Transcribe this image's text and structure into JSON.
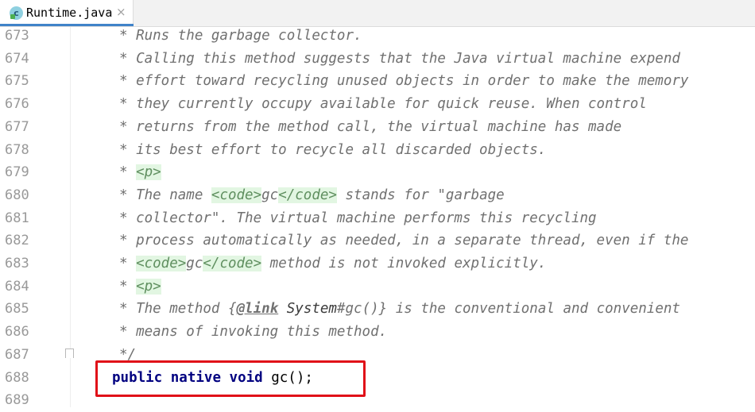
{
  "tab": {
    "icon": "class-icon",
    "icon_letter": "c",
    "label": "Runtime.java",
    "close": "×"
  },
  "lines": [
    {
      "n": "673",
      "text": "* Runs the garbage collector."
    },
    {
      "n": "674",
      "text": "* Calling this method suggests that the Java virtual machine expend"
    },
    {
      "n": "675",
      "text": "* effort toward recycling unused objects in order to make the memory"
    },
    {
      "n": "676",
      "text": "* they currently occupy available for quick reuse. When control"
    },
    {
      "n": "677",
      "text": "* returns from the method call, the virtual machine has made"
    },
    {
      "n": "678",
      "text": "* its best effort to recycle all discarded objects."
    },
    {
      "n": "679",
      "text": "* <p>"
    },
    {
      "n": "680",
      "text": "* The name <code>gc</code> stands for \"garbage"
    },
    {
      "n": "681",
      "text": "* collector\". The virtual machine performs this recycling"
    },
    {
      "n": "682",
      "text": "* process automatically as needed, in a separate thread, even if the"
    },
    {
      "n": "683",
      "text": "* <code>gc</code> method is not invoked explicitly."
    },
    {
      "n": "684",
      "text": "* <p>"
    },
    {
      "n": "685",
      "text": "* The method {@link System#gc()} is the conventional and convenient"
    },
    {
      "n": "686",
      "text": "* means of invoking this method."
    },
    {
      "n": "687",
      "text": "*/"
    },
    {
      "n": "688",
      "text": ""
    },
    {
      "n": "689",
      "text": ""
    }
  ],
  "parts": {
    "star": "* ",
    "p_tag": "<p>",
    "code_open": "<code>",
    "code_close": "</code>",
    "gc": "gc",
    "l680_a": "The name ",
    "l680_b": " stands for \"garbage",
    "l683_b": " method is not invoked explicitly.",
    "l685_a": "The method {",
    "l685_link": "@link",
    "l685_space": " ",
    "l685_ref": "System",
    "l685_b": "#gc()} is the conventional and convenient",
    "end_comment": "*/"
  },
  "java": {
    "kw1": "public",
    "kw2": "native",
    "kw3": "void",
    "rest": "gc();"
  },
  "colors": {
    "highlight": "#e01018",
    "keyword": "#000080",
    "comment": "#707070",
    "tag_bg": "#e2f6e2"
  }
}
